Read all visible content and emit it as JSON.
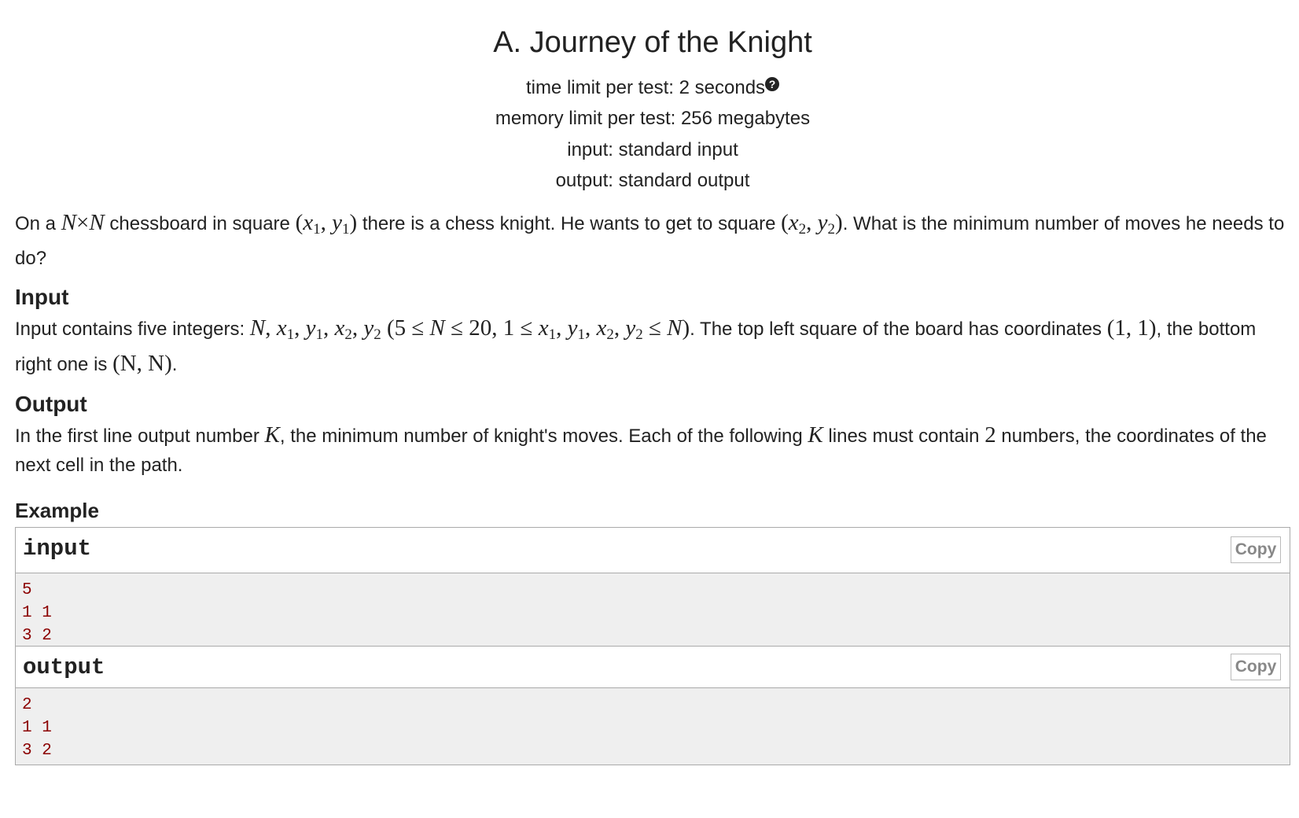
{
  "problem": {
    "title": "A. Journey of the Knight",
    "time_limit_label": "time limit per test: 2 seconds",
    "time_limit_icon": "question-circle-icon",
    "memory_limit_label": "memory limit per test: 256 megabytes",
    "input_label": "input: standard input",
    "output_label": "output: standard output"
  },
  "statement": {
    "t1": "On a ",
    "m1": "N",
    "m1b": "×",
    "m1c": "N",
    "t2": " chessboard in square ",
    "t3": " there is a chess knight. He wants to get to square ",
    "t4": ". What is the minimum number of moves he needs to do?"
  },
  "input_section": {
    "heading": "Input",
    "t1": "Input contains five integers: ",
    "t2": ". The top left square of the board has coordinates ",
    "coord_tl": "(1, 1)",
    "t3": ", the bottom right one is ",
    "coord_br": "(N, N)",
    "t4": "."
  },
  "output_section": {
    "heading": "Output",
    "t1": "In the first line output number ",
    "k": "K",
    "t2": ", the minimum number of knight's moves. Each of the following ",
    "k2": "K",
    "t3": " lines must contain ",
    "two": "2",
    "t4": " numbers, the coordinates of the next cell in the path."
  },
  "example": {
    "heading": "Example",
    "input": {
      "label": "input",
      "copy_label": "Copy",
      "lines": [
        "5",
        "1 1",
        "3 2"
      ]
    },
    "output": {
      "label": "output",
      "copy_label": "Copy",
      "lines": [
        "2",
        "1 1",
        "3 2"
      ]
    }
  }
}
